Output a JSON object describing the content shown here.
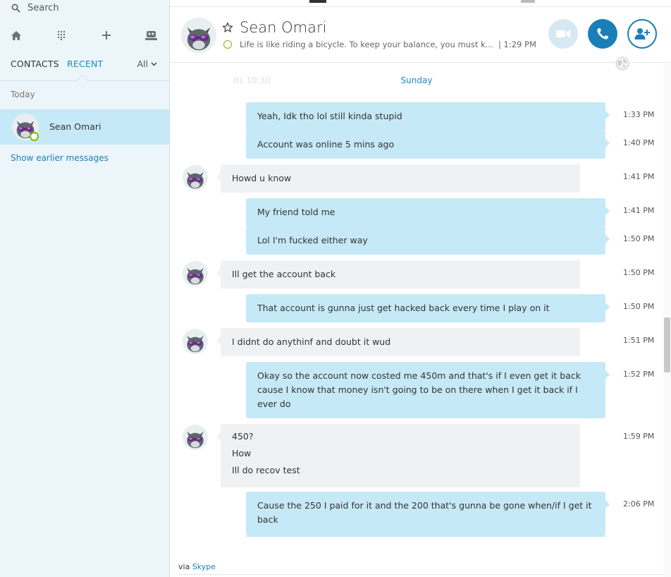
{
  "sidebar": {
    "search_placeholder": "Search",
    "tools": [
      "home-icon",
      "dialpad-icon",
      "add-icon",
      "bot-icon"
    ],
    "tabs": {
      "contacts": "CONTACTS",
      "recent": "RECENT"
    },
    "filter": "All",
    "section_label": "Today",
    "recent": [
      {
        "name": "Sean Omari",
        "status": "online"
      }
    ],
    "show_earlier": "Show earlier messages"
  },
  "header": {
    "name": "Sean Omari",
    "mood": "Life is like riding a bicycle. To keep your balance, you must keep m...",
    "time": "| 1:29 PM",
    "buttons": [
      "video-call",
      "voice-call",
      "add-people"
    ]
  },
  "chat": {
    "ghost_text": "Its 10:30",
    "date_separator": "Sunday",
    "messages": [
      {
        "dir": "out",
        "lines": [
          "Yeah, Idk tho lol still kinda stupid"
        ],
        "time": "1:33 PM"
      },
      {
        "dir": "out",
        "lines": [
          "Account was online 5 mins ago"
        ],
        "time": "1:40 PM"
      },
      {
        "dir": "in",
        "lines": [
          "Howd u know"
        ],
        "time": "1:41 PM"
      },
      {
        "dir": "out",
        "lines": [
          "My friend told me"
        ],
        "time": "1:41 PM"
      },
      {
        "dir": "out",
        "lines": [
          "Lol I'm fucked either way"
        ],
        "time": "1:50 PM"
      },
      {
        "dir": "in",
        "lines": [
          "Ill get the account back"
        ],
        "time": "1:50 PM"
      },
      {
        "dir": "out",
        "lines": [
          "That account is gunna just get hacked back every time I play on it"
        ],
        "time": "1:50 PM"
      },
      {
        "dir": "in",
        "lines": [
          "I didnt do anythinf and doubt it wud"
        ],
        "time": "1:51 PM"
      },
      {
        "dir": "out",
        "lines": [
          "Okay so the account now costed me 450m and that's if I even get it back cause I know that money isn't going to be on there when I get it back if I ever do"
        ],
        "time": "1:52 PM"
      },
      {
        "dir": "in",
        "lines": [
          "450?",
          "How",
          "Ill do recov test"
        ],
        "time": "1:59 PM"
      },
      {
        "dir": "out",
        "lines": [
          "Cause the 250 I paid for it and the 200 that's gunna be gone when/if I get it back"
        ],
        "time": "2:06 PM"
      }
    ]
  },
  "footer": {
    "prefix": "via",
    "link": "Skype"
  },
  "colors": {
    "accent": "#1a7fb8",
    "bubble_out": "#c6e9f7",
    "bubble_in": "#f0f1f3",
    "presence": "#7fba00",
    "sidebar_bg": "#ecf5fa"
  }
}
